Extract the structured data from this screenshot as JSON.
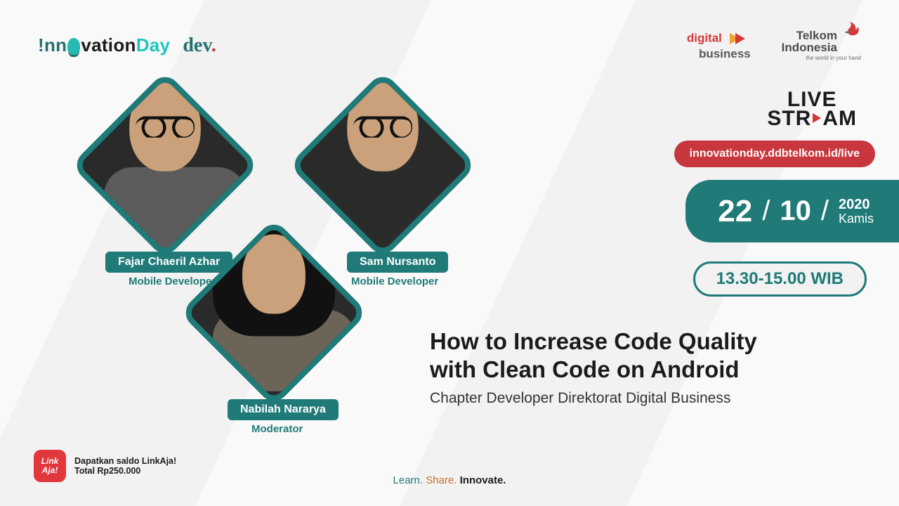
{
  "branding": {
    "innovation_pre": "!nn",
    "innovation_post": "vation",
    "innovation_day": "Day",
    "dev": "dev",
    "digital_top": "digital",
    "digital_bottom": "business",
    "telkom_line1": "Telkom",
    "telkom_line2": "Indonesia",
    "telkom_tag": "the world in your hand"
  },
  "speakers": [
    {
      "name": "Fajar Chaeril Azhar",
      "role": "Mobile Developer"
    },
    {
      "name": "Sam Nursanto",
      "role": "Mobile Developer"
    },
    {
      "name": "Nabilah Nararya",
      "role": "Moderator"
    }
  ],
  "livestream": {
    "line1": "LIVE",
    "line2": "STREAM",
    "url": "innovationday.ddbtelkom.id/live"
  },
  "date": {
    "day": "22",
    "month": "10",
    "year": "2020",
    "dow": "Kamis"
  },
  "time": "13.30-15.00 WIB",
  "title_line1": "How to Increase Code Quality",
  "title_line2": "with Clean Code on Android",
  "subtitle": "Chapter Developer Direktorat Digital Business",
  "footer": {
    "linkaja": "Link Aja!",
    "promo_l1": "Dapatkan saldo LinkAja!",
    "promo_l2": "Total Rp250.000"
  },
  "tagline": {
    "learn": "Learn.",
    "share": "Share.",
    "innovate": "Innovate."
  }
}
